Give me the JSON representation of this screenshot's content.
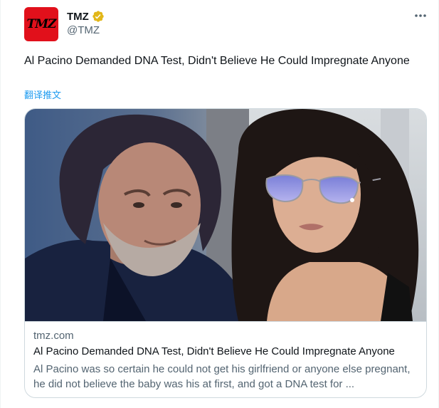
{
  "author": {
    "avatar_text": "TMZ",
    "display_name": "TMZ",
    "handle": "@TMZ",
    "verified_color": "#e2b719"
  },
  "tweet": {
    "text": "Al Pacino Demanded DNA Test, Didn't Believe He Could Impregnate Anyone",
    "translate_label": "翻译推文"
  },
  "card": {
    "domain": "tmz.com",
    "title": "Al Pacino Demanded DNA Test, Didn't Believe He Could Impregnate Anyone",
    "description": "Al Pacino was so certain he could not get his girlfriend or anyone else pregnant, he did not believe the baby was his at first, and got a DNA test for ..."
  },
  "icons": {
    "more": "more-icon",
    "verified": "verified-badge-icon"
  },
  "colors": {
    "accent": "#1d9bf0",
    "brand": "#e1101b",
    "secondary_text": "#536471"
  }
}
